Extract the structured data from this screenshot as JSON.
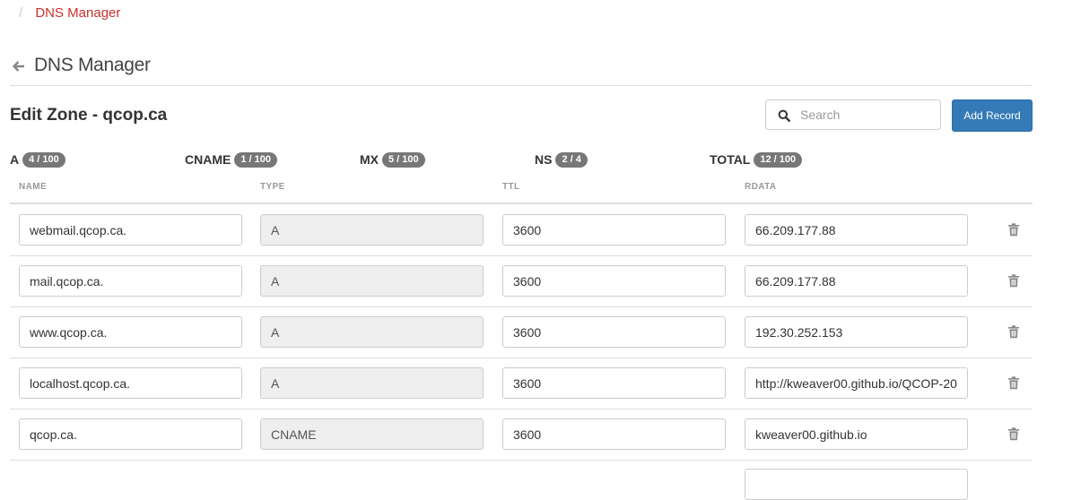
{
  "breadcrumb": {
    "separator": "/",
    "current": "DNS Manager"
  },
  "page": {
    "title": "DNS Manager",
    "back_icon": "arrow-left-icon"
  },
  "zone": {
    "title": "Edit Zone - qcop.ca"
  },
  "search": {
    "placeholder": "Search",
    "value": "",
    "icon": "search-icon"
  },
  "actions": {
    "add_record_label": "Add Record"
  },
  "counters": [
    {
      "label": "A",
      "badge": "4 / 100"
    },
    {
      "label": "CNAME",
      "badge": "1 / 100"
    },
    {
      "label": "MX",
      "badge": "5 / 100"
    },
    {
      "label": "NS",
      "badge": "2 / 4"
    },
    {
      "label": "TOTAL",
      "badge": "12 / 100"
    }
  ],
  "columns": [
    "NAME",
    "TYPE",
    "TTL",
    "RDATA"
  ],
  "records": [
    {
      "name": "webmail.qcop.ca.",
      "type": "A",
      "ttl": "3600",
      "rdata": "66.209.177.88"
    },
    {
      "name": "mail.qcop.ca.",
      "type": "A",
      "ttl": "3600",
      "rdata": "66.209.177.88"
    },
    {
      "name": "www.qcop.ca.",
      "type": "A",
      "ttl": "3600",
      "rdata": "192.30.252.153"
    },
    {
      "name": "localhost.qcop.ca.",
      "type": "A",
      "ttl": "3600",
      "rdata": "http://kweaver00.github.io/QCOP-20"
    },
    {
      "name": "qcop.ca.",
      "type": "CNAME",
      "ttl": "3600",
      "rdata": "kweaver00.github.io"
    }
  ],
  "colors": {
    "accent": "#337ab7",
    "breadcrumb": "#c9302c",
    "badge": "#777777",
    "readonly_bg": "#eeeeee"
  }
}
